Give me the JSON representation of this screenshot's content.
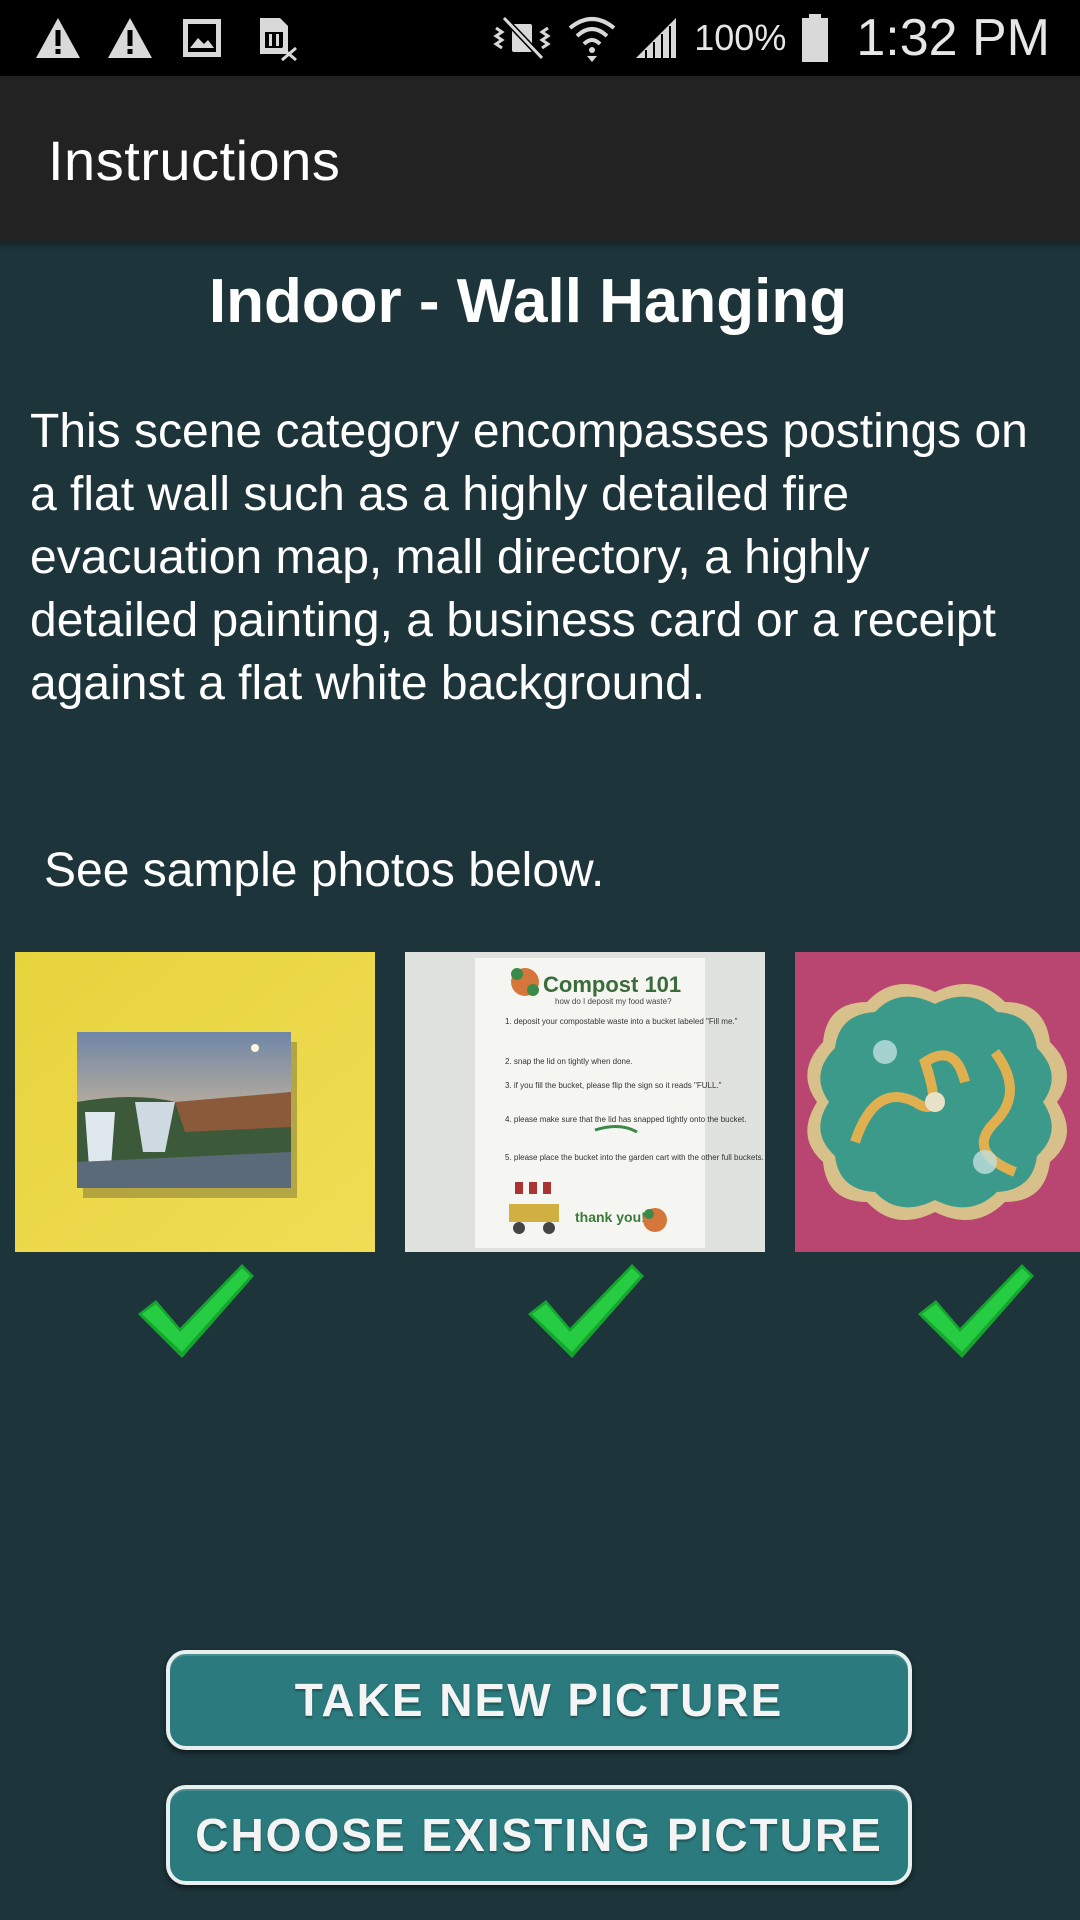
{
  "status_bar": {
    "left_icons": [
      "warning-icon",
      "warning-icon",
      "image-icon",
      "sim-card-off-icon"
    ],
    "right_icons": [
      "vibrate-icon",
      "wifi-icon",
      "signal-icon",
      "battery-icon"
    ],
    "battery_percent": "100%",
    "time": "1:32 PM"
  },
  "app_bar": {
    "title": "Instructions"
  },
  "content": {
    "scene_title": "Indoor - Wall Hanging",
    "description": "This scene category encompasses postings on a flat wall such as a highly detailed fire evacuation map, mall directory, a highly detailed painting, a business card or a receipt against a flat white background.",
    "sample_note": "See sample photos below.",
    "samples": [
      {
        "subject": "waterfall-painting-on-yellow-wall",
        "status": "check-icon"
      },
      {
        "subject": "compost-poster-on-white-wall",
        "status": "check-icon",
        "poster_title": "Compost 101",
        "poster_subtitle": "how do I deposit my food waste?",
        "poster_steps": [
          "1. deposit your compostable waste into a bucket labeled \"Fill me.\"",
          "2. snap the lid on tightly when done.",
          "3. if you fill the bucket, please flip the sign so it reads \"FULL.\"",
          "4. please make sure that the lid has snapped tightly onto the bucket.",
          "5. please place the bucket into the garden cart with the other full buckets."
        ],
        "poster_footer": "thank you!"
      },
      {
        "subject": "dragon-medallion-on-pink-wall",
        "status": "check-icon"
      }
    ],
    "check_color": "#1fbf3c"
  },
  "buttons": {
    "take_new": "TAKE NEW PICTURE",
    "choose_existing": "CHOOSE EXISTING PICTURE"
  },
  "colors": {
    "background": "#1c343a",
    "app_bar": "#222222",
    "button": "#2b7b7e",
    "button_border": "#e8efef"
  }
}
